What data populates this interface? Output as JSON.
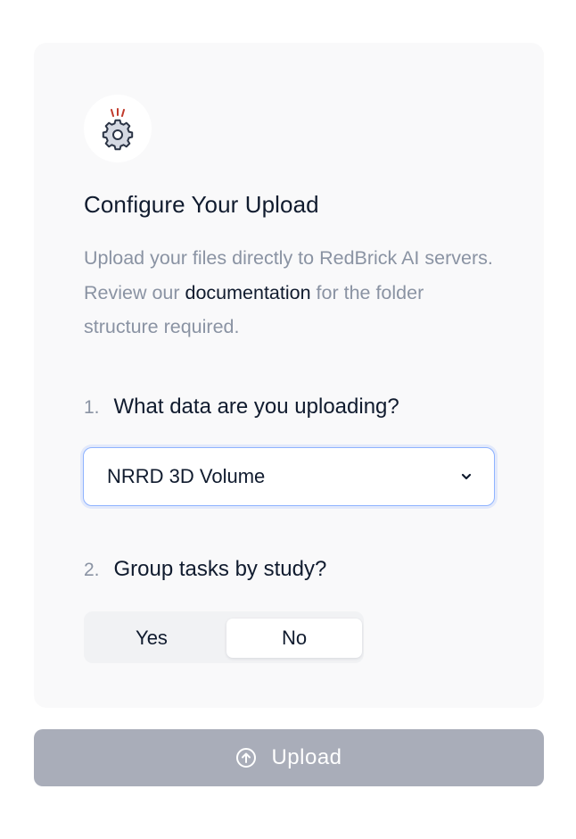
{
  "card": {
    "title": "Configure Your Upload",
    "description": {
      "before_link": "Upload your files directly to RedBrick AI servers. Review our ",
      "link_text": "documentation",
      "after_link": " for the folder structure required."
    },
    "icon": "gear-alert-icon"
  },
  "question_1": {
    "number": "1.",
    "text": "What data are you uploading?",
    "select": {
      "value": "NRRD 3D Volume",
      "icon": "chevron-down-icon"
    }
  },
  "question_2": {
    "number": "2.",
    "text": "Group tasks by study?",
    "options": [
      "Yes",
      "No"
    ],
    "selected": "No"
  },
  "upload_button": {
    "label": "Upload",
    "icon": "upload-circle-icon",
    "state": "disabled"
  },
  "colors": {
    "card_bg": "#f9f9fa",
    "text_primary": "#101b2e",
    "text_muted": "#8a93a3",
    "focus_border": "#8fb3ff",
    "button_disabled": "#a9adb9",
    "alert_red": "#c0392b"
  }
}
